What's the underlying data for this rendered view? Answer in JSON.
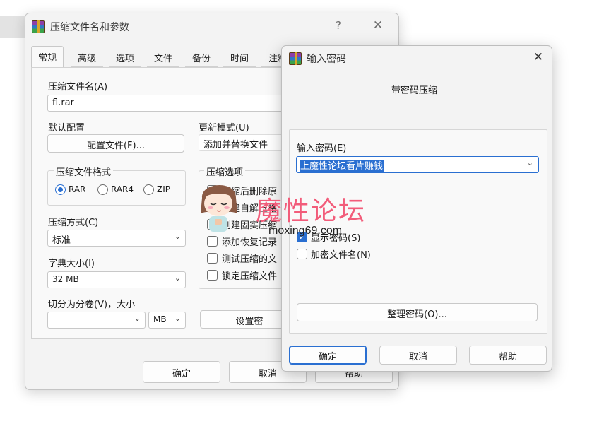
{
  "main": {
    "title": "压缩文件名和参数",
    "help_glyph": "?",
    "close_glyph": "✕",
    "tabs": [
      "常规",
      "高级",
      "选项",
      "文件",
      "备份",
      "时间",
      "注释"
    ],
    "archive_name_label": "压缩文件名(A)",
    "archive_name_value": "fl.rar",
    "default_profile_label": "默认配置",
    "profiles_button": "配置文件(F)...",
    "update_mode_label": "更新模式(U)",
    "update_mode_value": "添加并替换文件",
    "format_group_label": "压缩文件格式",
    "formats": [
      "RAR",
      "RAR4",
      "ZIP"
    ],
    "options_group_label": "压缩选项",
    "options": [
      "压缩后删除原",
      "创建自解压格",
      "创建固实压缩",
      "添加恢复记录",
      "测试压缩的文",
      "锁定压缩文件"
    ],
    "method_label": "压缩方式(C)",
    "method_value": "标准",
    "dict_label": "字典大小(I)",
    "dict_value": "32 MB",
    "split_label": "切分为分卷(V)，大小",
    "split_unit": "MB",
    "set_password_button": "设置密",
    "ok_button": "确定",
    "cancel_button": "取消",
    "help_button": "帮助"
  },
  "password": {
    "title": "输入密码",
    "close_glyph": "✕",
    "subtitle": "带密码压缩",
    "input_label": "输入密码(E)",
    "input_value": "上魔性论坛看片赚钱",
    "show_password": "显示密码(S)",
    "encrypt_names": "加密文件名(N)",
    "organize_button": "整理密码(O)...",
    "ok_button": "确定",
    "cancel_button": "取消",
    "help_button": "帮助"
  },
  "watermark": {
    "title": "魔性论坛",
    "url": "moxing69.com"
  },
  "colors": {
    "accent": "#2a6fd1",
    "watermark_pink": "#f25c7a"
  }
}
